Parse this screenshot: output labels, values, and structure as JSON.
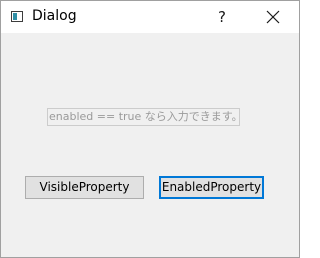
{
  "window": {
    "title": "Dialog",
    "help_label": "?",
    "close_icon": "close-icon"
  },
  "content": {
    "line_edit_text": "enabled == true なら入力できます。",
    "visible_property_label": "VisibleProperty",
    "enabled_property_label": "EnabledProperty"
  },
  "colors": {
    "focus_border": "#0078d7",
    "window_bg": "#f0f0f0",
    "titlebar_bg": "#ffffff",
    "disabled_text": "#9a9a9a"
  }
}
